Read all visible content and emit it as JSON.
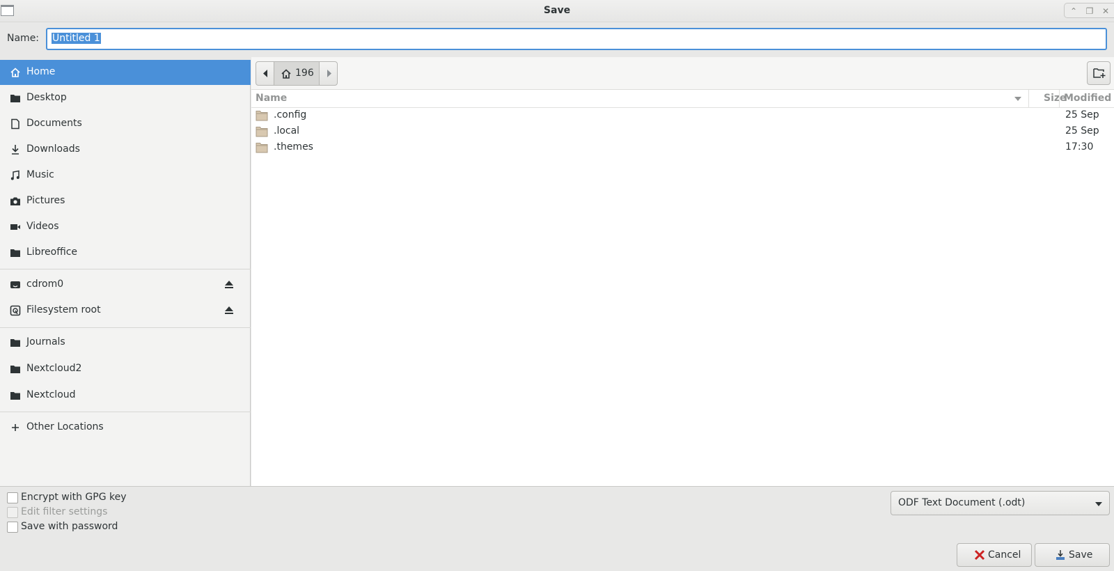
{
  "window": {
    "title": "Save"
  },
  "name_row": {
    "label": "Name:",
    "value": "Untitled 1"
  },
  "sidebar": {
    "places": [
      {
        "label": "Home",
        "icon": "home-icon",
        "active": true
      },
      {
        "label": "Desktop",
        "icon": "folder-icon"
      },
      {
        "label": "Documents",
        "icon": "document-icon"
      },
      {
        "label": "Downloads",
        "icon": "download-icon"
      },
      {
        "label": "Music",
        "icon": "music-icon"
      },
      {
        "label": "Pictures",
        "icon": "camera-icon"
      },
      {
        "label": "Videos",
        "icon": "video-icon"
      },
      {
        "label": "Libreoffice",
        "icon": "folder-icon"
      }
    ],
    "devices": [
      {
        "label": "cdrom0",
        "icon": "drive-icon"
      },
      {
        "label": "Filesystem root",
        "icon": "harddisk-icon"
      }
    ],
    "bookmarks": [
      {
        "label": "Journals",
        "icon": "folder-icon"
      },
      {
        "label": "Nextcloud2",
        "icon": "folder-icon"
      },
      {
        "label": "Nextcloud",
        "icon": "folder-icon"
      }
    ],
    "other": {
      "label": "Other Locations",
      "icon": "plus-icon"
    }
  },
  "pathbar": {
    "crumb": "196"
  },
  "columns": {
    "name": "Name",
    "size": "Size",
    "modified": "Modified"
  },
  "files": [
    {
      "name": ".config",
      "size": "",
      "modified": "25 Sep"
    },
    {
      "name": ".local",
      "size": "",
      "modified": "25 Sep"
    },
    {
      "name": ".themes",
      "size": "",
      "modified": "17:30"
    }
  ],
  "options": {
    "encrypt": "Encrypt with GPG key",
    "edit_filter": "Edit filter settings",
    "save_password": "Save with password"
  },
  "filter": {
    "selected": "ODF Text Document (.odt)"
  },
  "buttons": {
    "cancel": "Cancel",
    "save": "Save"
  },
  "colors": {
    "accent": "#4a90d9",
    "folder": "#d8c8b0"
  }
}
